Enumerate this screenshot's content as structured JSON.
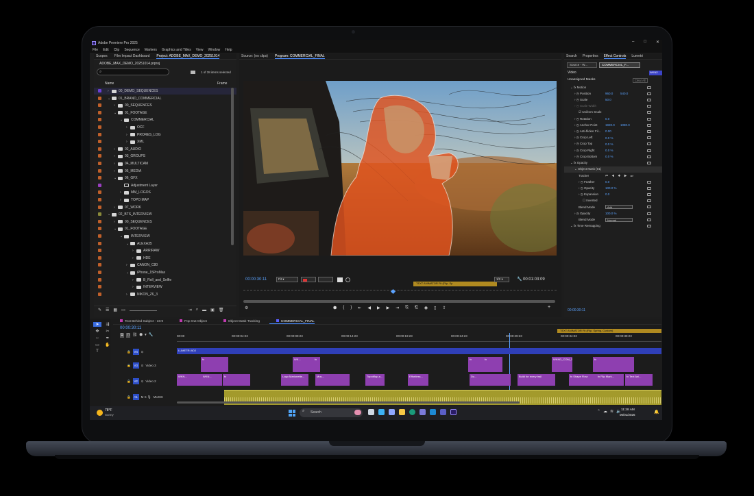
{
  "app": {
    "title": "Adobe Premiere Pro 2025"
  },
  "menu": [
    "File",
    "Edit",
    "Clip",
    "Sequence",
    "Markers",
    "Graphics and Titles",
    "View",
    "Window",
    "Help"
  ],
  "project_panel": {
    "tabs": [
      "Scopes",
      "Film Impact Dashboard",
      "Project: ADOBE_MAX_DEMO_20251014"
    ],
    "file": "ADOBE_MAX_DEMO_20251014.prproj",
    "selection": "1 of 38 items selected",
    "col_name": "Name",
    "col_frame": "Frame",
    "items": [
      {
        "label": "00_DEMO_SEQUENCES",
        "indent": 0,
        "open": false,
        "color": "#6b3fd4"
      },
      {
        "label": "01_BRAND_COMMERCIAL",
        "indent": 0,
        "open": true,
        "color": "#c0602a"
      },
      {
        "label": "00_SEQUENCES",
        "indent": 1,
        "open": false,
        "color": "#c0602a"
      },
      {
        "label": "01_FOOTAGE",
        "indent": 1,
        "open": true,
        "color": "#c0602a"
      },
      {
        "label": "COMMERCIAL",
        "indent": 2,
        "open": true,
        "color": "#c0602a"
      },
      {
        "label": "OCF",
        "indent": 3,
        "open": false,
        "color": "#c0602a"
      },
      {
        "label": "PRORES_LOG",
        "indent": 3,
        "open": false,
        "color": "#c0602a"
      },
      {
        "label": "XML",
        "indent": 3,
        "open": false,
        "color": "#c0602a"
      },
      {
        "label": "02_AUDIO",
        "indent": 1,
        "open": false,
        "color": "#c0602a"
      },
      {
        "label": "03_GROUPS",
        "indent": 1,
        "open": false,
        "color": "#c0602a"
      },
      {
        "label": "04_MULTICAM",
        "indent": 1,
        "open": false,
        "color": "#c0602a"
      },
      {
        "label": "05_MEDIA",
        "indent": 1,
        "open": false,
        "color": "#c0602a"
      },
      {
        "label": "06_GFX",
        "indent": 1,
        "open": true,
        "color": "#c0602a"
      },
      {
        "label": "Adjustment Layer",
        "indent": 2,
        "open": null,
        "color": "#9a3fc0"
      },
      {
        "label": "MM_LOGOS",
        "indent": 2,
        "open": false,
        "color": "#c0602a"
      },
      {
        "label": "TOPO MAP",
        "indent": 2,
        "open": false,
        "color": "#c0602a"
      },
      {
        "label": "07_WORK",
        "indent": 1,
        "open": false,
        "color": "#c0602a"
      },
      {
        "label": "02_BTS_INTERVIEW",
        "indent": 0,
        "open": true,
        "color": "#8a8a3a"
      },
      {
        "label": "00_SEQUENCES",
        "indent": 1,
        "open": false,
        "color": "#c0602a"
      },
      {
        "label": "01_FOOTAGE",
        "indent": 1,
        "open": true,
        "color": "#c0602a"
      },
      {
        "label": "INTERVIEW",
        "indent": 2,
        "open": true,
        "color": "#c0602a"
      },
      {
        "label": "ALEXA35",
        "indent": 3,
        "open": true,
        "color": "#c0602a"
      },
      {
        "label": "ARRIRAW",
        "indent": 4,
        "open": false,
        "color": "#c0602a"
      },
      {
        "label": "HDE",
        "indent": 4,
        "open": false,
        "color": "#c0602a"
      },
      {
        "label": "CANON_C80",
        "indent": 3,
        "open": false,
        "color": "#c0602a"
      },
      {
        "label": "iPhone_15ProMax",
        "indent": 3,
        "open": true,
        "color": "#c0602a"
      },
      {
        "label": "B_Roll_and_Selfie",
        "indent": 4,
        "open": false,
        "color": "#c0602a"
      },
      {
        "label": "INTERVIEW",
        "indent": 4,
        "open": false,
        "color": "#c0602a"
      },
      {
        "label": "NIKON_Z6_3",
        "indent": 3,
        "open": false,
        "color": "#c0602a"
      }
    ]
  },
  "program": {
    "source_tab": "Source: (no clips)",
    "program_tab": "Program: COMMERCIAL_FINAL",
    "timecode": "00:00:30:11",
    "fit": "Fit",
    "quality": "1/2",
    "duration": "00:01:03:09",
    "marker_label": "TEXT ANIMATOR Fit (Flip, Sp"
  },
  "effect_controls": {
    "tabs": [
      "Search",
      "Properties",
      "Effect Controls",
      "Lumetri"
    ],
    "source_btn": "Source - W...",
    "clip_btn": "COMMERCIAL_F...",
    "clip_chip": "WKN2",
    "video_label": "Video",
    "unassigned": "Unassigned Masks",
    "clear_all": "Clear All",
    "rows": [
      {
        "label": "Motion",
        "indent": 1,
        "fx": true
      },
      {
        "label": "Position",
        "indent": 2,
        "v1": "960.0",
        "v2": "540.0"
      },
      {
        "label": "Scale",
        "indent": 2,
        "v1": "50.0",
        "v2": ""
      },
      {
        "label": "Scale Width",
        "indent": 2,
        "v1": "",
        "v2": "",
        "dim": true
      },
      {
        "label": "Uniform Scale",
        "indent": 3,
        "check": true
      },
      {
        "label": "Rotation",
        "indent": 2,
        "v1": "0.0",
        "v2": ""
      },
      {
        "label": "Anchor Point",
        "indent": 2,
        "v1": "1920.0",
        "v2": "1080.0"
      },
      {
        "label": "Anti-flicker Fil...",
        "indent": 2,
        "v1": "0.00",
        "v2": ""
      },
      {
        "label": "Crop Left",
        "indent": 2,
        "v1": "0.0 %",
        "v2": ""
      },
      {
        "label": "Crop Top",
        "indent": 2,
        "v1": "0.0 %",
        "v2": ""
      },
      {
        "label": "Crop Right",
        "indent": 2,
        "v1": "0.0 %",
        "v2": ""
      },
      {
        "label": "Crop Bottom",
        "indent": 2,
        "v1": "0.0 %",
        "v2": ""
      },
      {
        "label": "Opacity",
        "indent": 1,
        "fx": true
      },
      {
        "label": "Object Mask (01)",
        "indent": 2,
        "highlight": true
      },
      {
        "label": "Tracker",
        "indent": 3,
        "tracker": true
      },
      {
        "label": "Feather",
        "indent": 3,
        "v1": "0.0",
        "v2": ""
      },
      {
        "label": "Opacity",
        "indent": 3,
        "v1": "100.0 %",
        "v2": ""
      },
      {
        "label": "Expansion",
        "indent": 3,
        "v1": "0.0",
        "v2": ""
      },
      {
        "label": "Inverted",
        "indent": 4,
        "check": false
      },
      {
        "label": "Blend Mode",
        "indent": 3,
        "dropdown": "Add"
      },
      {
        "label": "Opacity",
        "indent": 2,
        "v1": "100.0 %",
        "v2": ""
      },
      {
        "label": "Blend Mode",
        "indent": 3,
        "dropdown": "Normal"
      },
      {
        "label": "Time Remapping",
        "indent": 1,
        "fx": true
      }
    ],
    "footer_tc": "00:00:30:11"
  },
  "timeline": {
    "tabs": [
      "Text Behind Subject - 16:9",
      "Pop Out Object",
      "Object Mask Tracking",
      "COMMERCIAL_FINAL"
    ],
    "timecode": "00:00:30:11",
    "ruler": [
      "00:00",
      "00:00:04:23",
      "00:00:09:23",
      "00:00:14:23",
      "00:00:19:23",
      "00:00:24:23",
      "00:00:29:23",
      "00:00:34:23",
      "00:00:39:23"
    ],
    "marker_label": "TEXT ANIMATOR Fit (Flip, Spring, Custom)",
    "tracks": [
      {
        "id": "V4",
        "name": ""
      },
      {
        "id": "V3",
        "name": "Video 3"
      },
      {
        "id": "V2",
        "name": "Video 2"
      },
      {
        "id": "A1",
        "name": "MUSIC"
      }
    ],
    "v4_clip": "LUMETRI ADJ",
    "v3_clips": [
      "fx",
      "WK...",
      "fx",
      "fx",
      "fx",
      "WKND_COM_2...",
      "fx"
    ],
    "v2_clips": [
      "WKN...",
      "WKN...",
      "fx",
      "Logo Marionette...",
      "Mou...",
      "TopoMap.a...",
      "Effortless...",
      "Du...",
      "Build for every trail",
      "fx Shape Flow",
      "fx Flip Mark...",
      "fx Text Ani..."
    ]
  },
  "taskbar": {
    "temp": "78°F",
    "weather": "Sunny",
    "search": "Search",
    "time": "11:28 AM",
    "date": "06/01/2026"
  },
  "colors": {
    "accent": "#4a8cff",
    "clip_violet": "#8e3fb0",
    "clip_blue": "#2f3fb8",
    "audio": "#a39a2c",
    "mask_orange": "#e2531e"
  }
}
